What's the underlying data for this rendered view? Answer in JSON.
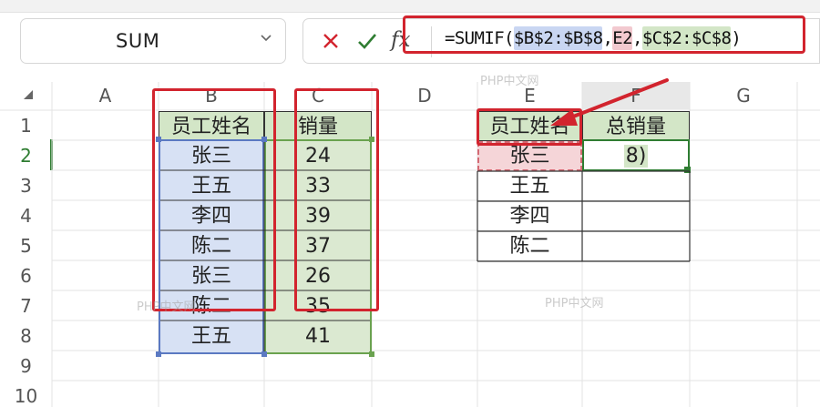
{
  "name_box": {
    "value": "SUM"
  },
  "formula_bar": {
    "prefix": "=SUMIF(",
    "arg1": "$B$2:$B$8",
    "comma1": ",",
    "arg2": "E2",
    "comma2": ",",
    "arg3": "$C$2:$C$8",
    "suffix": ")"
  },
  "columns": [
    "A",
    "B",
    "C",
    "D",
    "E",
    "F",
    "G"
  ],
  "rows": [
    "1",
    "2",
    "3",
    "4",
    "5",
    "6",
    "7",
    "8",
    "9",
    "10"
  ],
  "source_table": {
    "headers": [
      "员工姓名",
      "销量"
    ],
    "rows": [
      [
        "张三",
        "24"
      ],
      [
        "王五",
        "33"
      ],
      [
        "李四",
        "39"
      ],
      [
        "陈二",
        "37"
      ],
      [
        "张三",
        "26"
      ],
      [
        "陈二",
        "35"
      ],
      [
        "王五",
        "41"
      ]
    ]
  },
  "summary_table": {
    "headers": [
      "员工姓名",
      "总销量"
    ],
    "names": [
      "张三",
      "王五",
      "李四",
      "陈二"
    ],
    "f2_edit": "8)"
  },
  "watermark": "PHP中文网",
  "colors": {
    "accent_green": "#2f7d32",
    "annotation_red": "#d2242e",
    "range_blue": "#d7e1f4",
    "range_green": "#dbe9d1",
    "ref_red": "#f5d5d8"
  }
}
